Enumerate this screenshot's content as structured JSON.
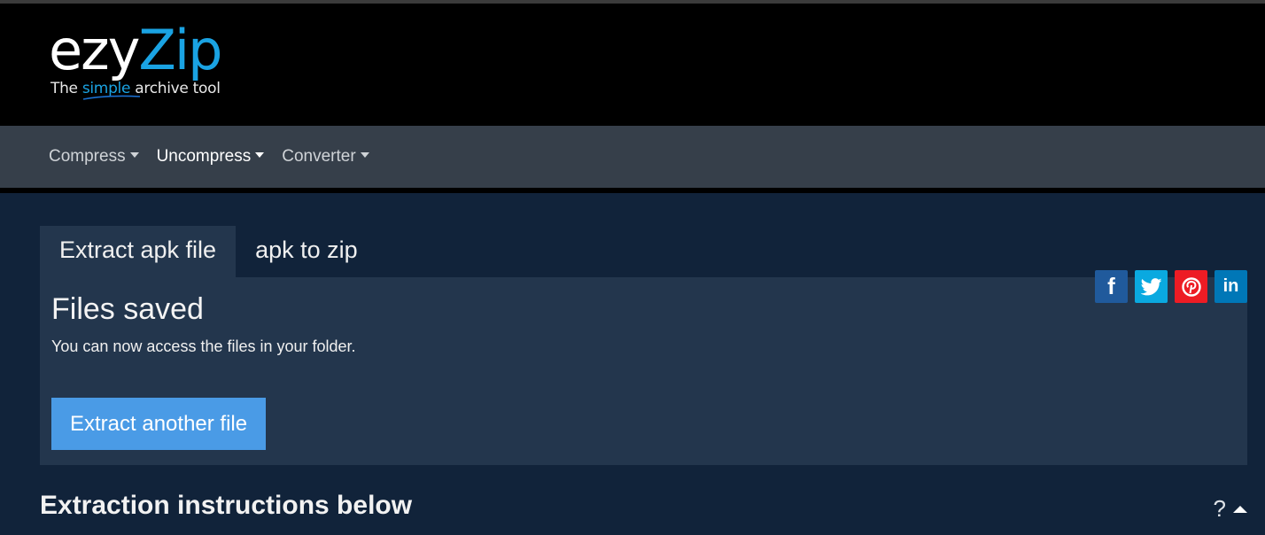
{
  "header": {
    "logo_part1": "ezy",
    "logo_part2": "Zip",
    "tagline_pre": "The ",
    "tagline_highlight": "simple",
    "tagline_post": " archive tool",
    "brand_color": "#1aa3e3"
  },
  "nav": {
    "items": [
      {
        "label": "Compress",
        "active": false
      },
      {
        "label": "Uncompress",
        "active": true
      },
      {
        "label": "Converter",
        "active": false
      }
    ]
  },
  "tabs": [
    {
      "label": "Extract apk file",
      "active": true
    },
    {
      "label": "apk to zip",
      "active": false
    }
  ],
  "share": {
    "buttons": [
      {
        "network": "facebook",
        "icon": "facebook-icon",
        "glyph": "f",
        "color": "#205a9c"
      },
      {
        "network": "twitter",
        "icon": "twitter-icon",
        "color": "#0aa9e0"
      },
      {
        "network": "pinterest",
        "icon": "pinterest-icon",
        "color": "#ed1c24"
      },
      {
        "network": "linkedin",
        "icon": "linkedin-icon",
        "glyph": "in",
        "color": "#0077b7"
      }
    ]
  },
  "panel": {
    "title": "Files saved",
    "message": "You can now access the files in your folder.",
    "button_label": "Extract another file",
    "button_color": "#4a9be6"
  },
  "instructions": {
    "title": "Extraction instructions below",
    "help_label": "?"
  }
}
